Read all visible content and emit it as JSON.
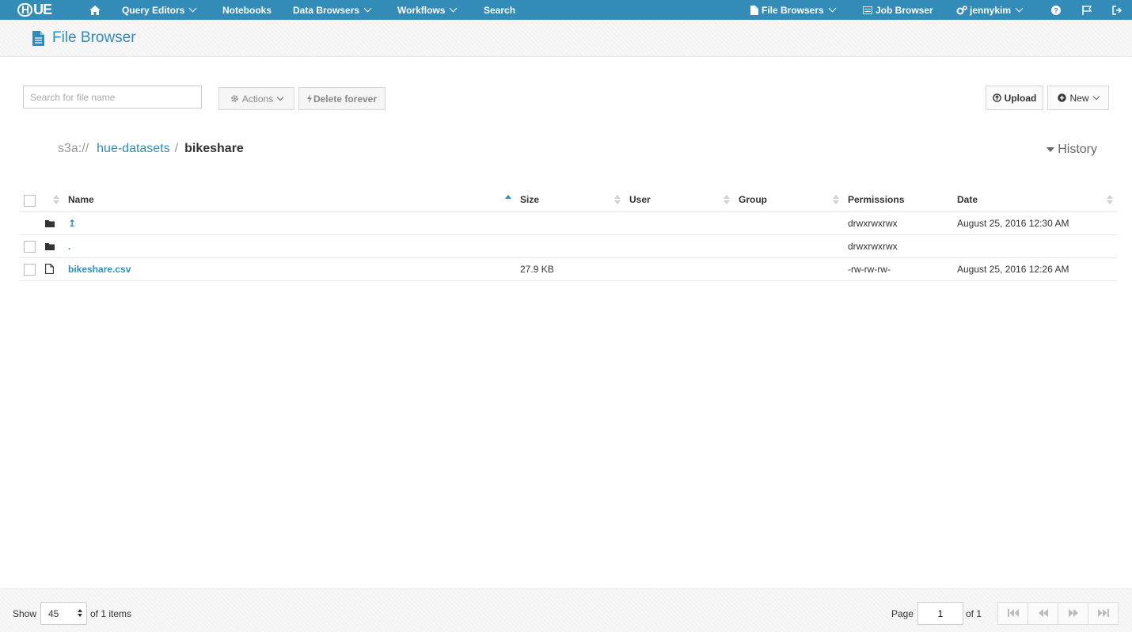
{
  "navbar": {
    "logo": "HUE",
    "items": [
      {
        "label": "Query Editors",
        "has_menu": true
      },
      {
        "label": "Notebooks",
        "has_menu": false
      },
      {
        "label": "Data Browsers",
        "has_menu": true
      },
      {
        "label": "Workflows",
        "has_menu": true
      },
      {
        "label": "Search",
        "has_menu": false
      }
    ],
    "right": {
      "file_browsers": "File Browsers",
      "job_browser": "Job Browser",
      "user": "jennykim"
    },
    "icons": [
      "home-icon",
      "help-icon",
      "flag-icon",
      "logout-icon"
    ],
    "color": "#338bb8"
  },
  "app": {
    "title": "File Browser",
    "icon": "file-icon"
  },
  "toolbar": {
    "search_placeholder": "Search for file name",
    "actions_label": "Actions",
    "delete_label": "Delete forever",
    "upload_label": "Upload",
    "new_label": "New"
  },
  "breadcrumb": {
    "scheme": "s3a://",
    "bucket": "hue-datasets",
    "separator": "/",
    "current": "bikeshare"
  },
  "history_label": "History",
  "table": {
    "columns": [
      "Name",
      "Size",
      "User",
      "Group",
      "Permissions",
      "Date"
    ],
    "rows": [
      {
        "type": "folder",
        "name": "↥",
        "size": "",
        "user": "",
        "group": "",
        "permissions": "drwxrwxrwx",
        "date": "August 25, 2016 12:30 AM",
        "checkbox": false
      },
      {
        "type": "folder",
        "name": ".",
        "size": "",
        "user": "",
        "group": "",
        "permissions": "drwxrwxrwx",
        "date": "",
        "checkbox": true
      },
      {
        "type": "file",
        "name": "bikeshare.csv",
        "size": "27.9 KB",
        "user": "",
        "group": "",
        "permissions": "-rw-rw-rw-",
        "date": "August 25, 2016 12:26 AM",
        "checkbox": true
      }
    ]
  },
  "footer": {
    "show_label": "Show",
    "page_size": "45",
    "items_label": "of 1 items",
    "page_label": "Page",
    "page_value": "1",
    "of_pages_label": "of 1"
  }
}
